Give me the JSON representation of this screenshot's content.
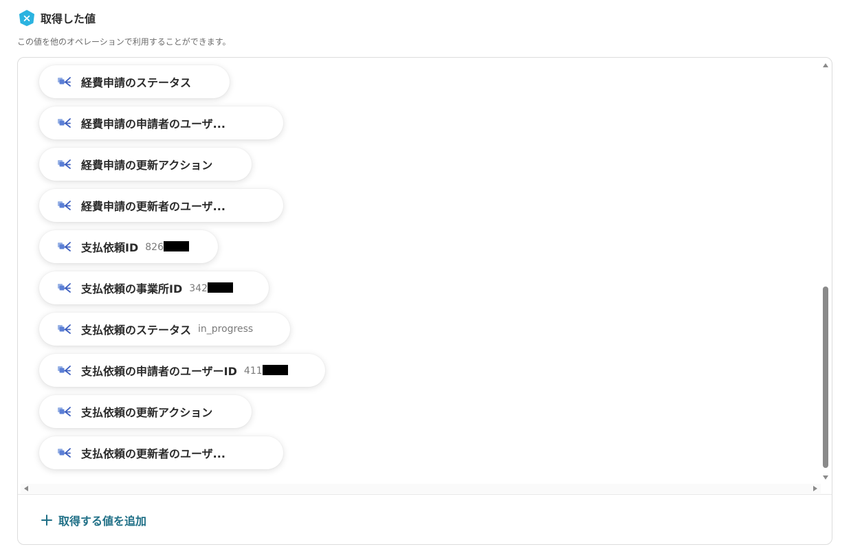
{
  "header": {
    "title": "取得した値",
    "icon": "yoom-hexagon-icon",
    "icon_color": "#2bb3e0"
  },
  "subtitle": "この値を他のオペレーションで利用することができます。",
  "items": [
    {
      "label": "経費申請のステータス",
      "value": "",
      "redacted": false
    },
    {
      "label": "経費申請の申請者のユーザ...",
      "value": "",
      "redacted": false
    },
    {
      "label": "経費申請の更新アクション",
      "value": "",
      "redacted": false
    },
    {
      "label": "経費申請の更新者のユーザ...",
      "value": "",
      "redacted": false
    },
    {
      "label": "支払依頼ID",
      "value": "826",
      "redacted": true
    },
    {
      "label": "支払依頼の事業所ID",
      "value": "342",
      "redacted": true
    },
    {
      "label": "支払依頼のステータス",
      "value": "in_progress",
      "redacted": false
    },
    {
      "label": "支払依頼の申請者のユーザーID",
      "value": "411",
      "redacted": true
    },
    {
      "label": "支払依頼の更新アクション",
      "value": "",
      "redacted": false
    },
    {
      "label": "支払依頼の更新者のユーザ...",
      "value": "",
      "redacted": false
    }
  ],
  "item_icon": "app-link-icon",
  "add_button": {
    "label": "取得する値を追加",
    "icon": "plus-icon",
    "color": "#1f6f86"
  }
}
